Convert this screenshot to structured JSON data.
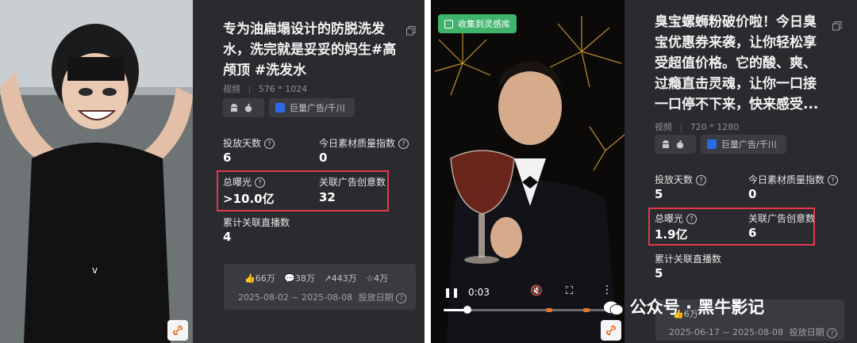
{
  "cards": [
    {
      "title": "专为油扁塌设计的防脱洗发水，洗完就是妥妥的妈生#高颅顶 #洗发水",
      "type": "视频",
      "resolution": "576 * 1024",
      "platform_label": "巨量广告/千川",
      "stats": {
        "days_label": "投放天数",
        "days_value": "6",
        "quality_label": "今日素材质量指数",
        "quality_value": "0",
        "exposure_label": "总曝光",
        "exposure_value": ">10.0亿",
        "creatives_label": "关联广告创意数",
        "creatives_value": "32",
        "live_label": "累计关联直播数",
        "live_value": "4"
      },
      "engagement": {
        "likes": "66万",
        "comments": "38万",
        "shares": "443万",
        "favorites": "4万"
      },
      "date_range": "2025-08-02 ~ 2025-08-08",
      "date_label": "投放日期"
    },
    {
      "title": "臭宝螺蛳粉破价啦！今日臭宝优惠券来袭，让你轻松享受超值价格。它的酸、爽、过瘾直击灵魂，让你一口接一口停不下来，快来感受...",
      "type": "视频",
      "resolution": "720 * 1280",
      "platform_label": "巨量广告/千川",
      "collect_label": "收集到灵感库",
      "player_time": "0:03",
      "stats": {
        "days_label": "投放天数",
        "days_value": "5",
        "quality_label": "今日素材质量指数",
        "quality_value": "0",
        "exposure_label": "总曝光",
        "exposure_value": "1.9亿",
        "creatives_label": "关联广告创意数",
        "creatives_value": "6",
        "live_label": "累计关联直播数",
        "live_value": "5"
      },
      "engagement": {
        "likes": "6万",
        "comments": "",
        "shares": "",
        "favorites": ""
      },
      "date_range": "2025-06-17 ~ 2025-08-08",
      "date_label": "投放日期"
    }
  ],
  "watermark": "公众号 · 黑牛影记",
  "colors": {
    "panel_bg": "#2a2b2f",
    "highlight": "#e23a4b",
    "collect_green": "#3fb36b"
  }
}
